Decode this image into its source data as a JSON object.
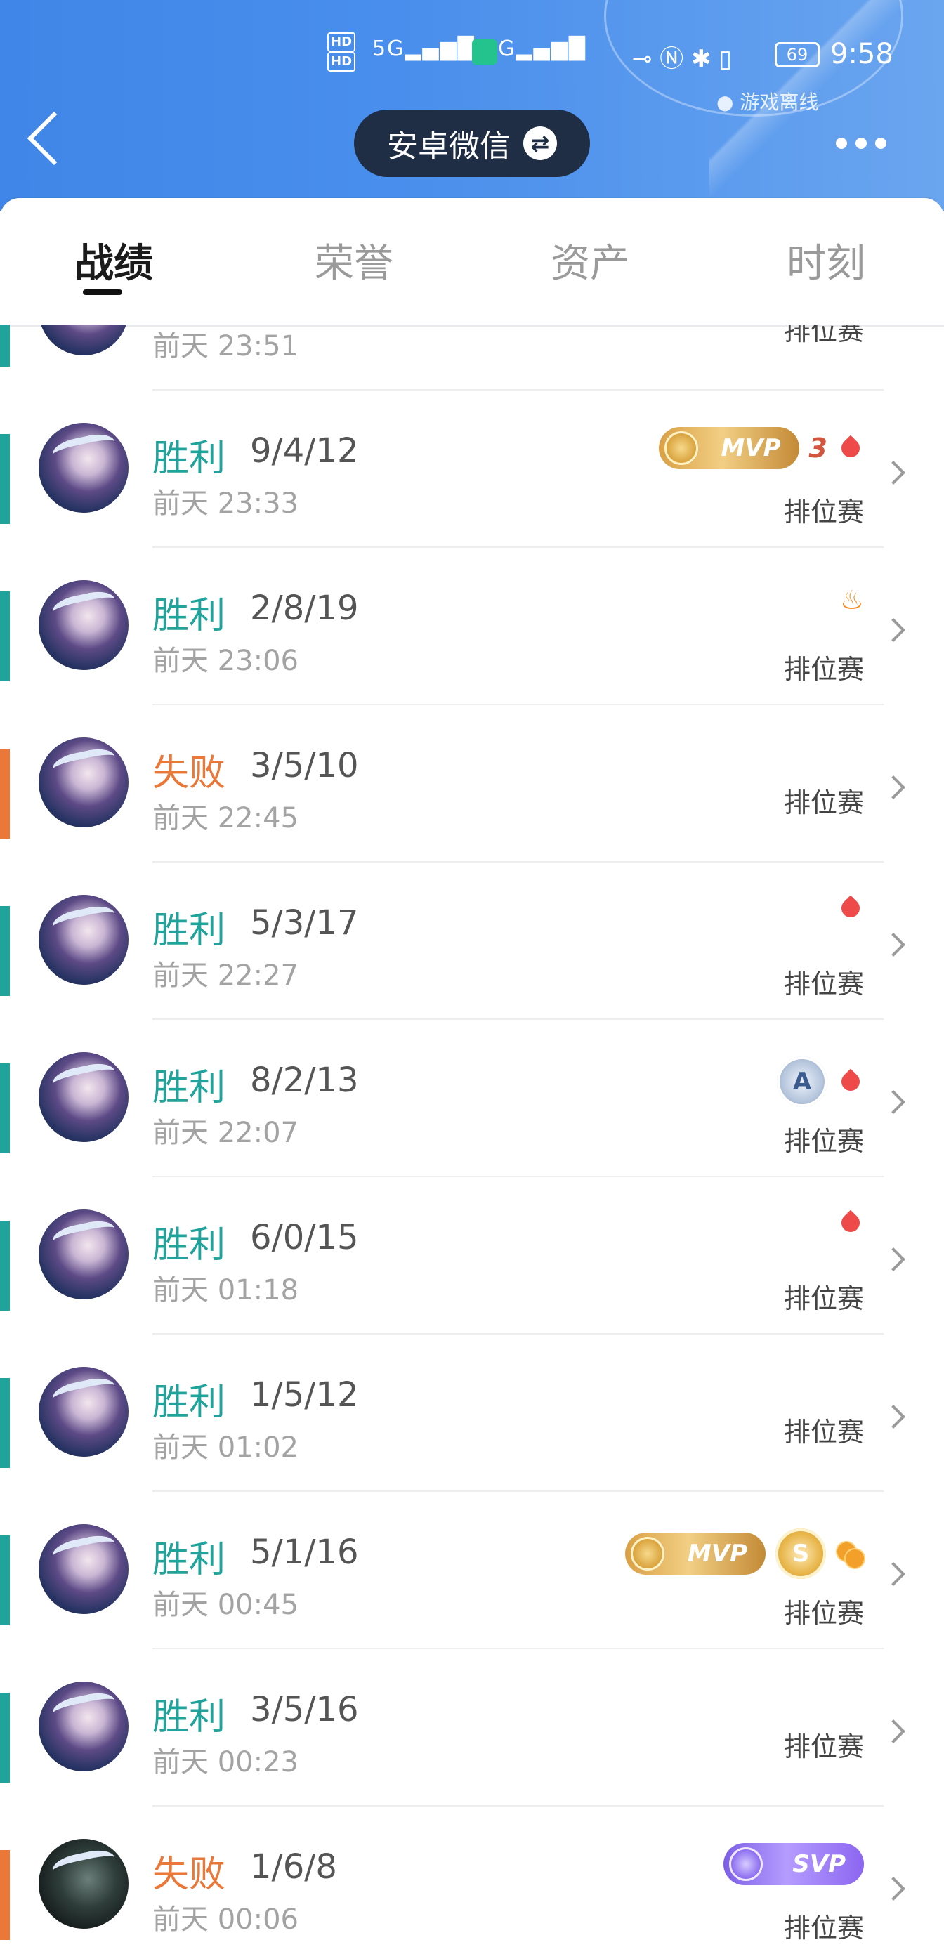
{
  "status_bar": {
    "network": "HD 5G 4G",
    "battery": "69",
    "time": "9:58",
    "presence": "游戏离线"
  },
  "header": {
    "account_label": "安卓微信"
  },
  "tabs": [
    {
      "label": "战绩"
    },
    {
      "label": "荣誉"
    },
    {
      "label": "资产"
    },
    {
      "label": "时刻"
    }
  ],
  "colors": {
    "win": "#1fa39a",
    "lose": "#ea7838",
    "accent_blue": "#4a8fec"
  },
  "matches": [
    {
      "result": "",
      "kda": "",
      "time": "前天 23:51",
      "mode": "排位赛",
      "outcome": "win",
      "badges": []
    },
    {
      "result": "胜利",
      "kda": "9/4/12",
      "time": "前天 23:33",
      "mode": "排位赛",
      "outcome": "win",
      "badges": [
        "mvp",
        "triple",
        "drop"
      ],
      "triple_label": "3",
      "mvp_label": "MVP"
    },
    {
      "result": "胜利",
      "kda": "2/8/19",
      "time": "前天 23:06",
      "mode": "排位赛",
      "outcome": "win",
      "badges": [
        "fire"
      ]
    },
    {
      "result": "失败",
      "kda": "3/5/10",
      "time": "前天 22:45",
      "mode": "排位赛",
      "outcome": "lose",
      "badges": []
    },
    {
      "result": "胜利",
      "kda": "5/3/17",
      "time": "前天 22:27",
      "mode": "排位赛",
      "outcome": "win",
      "badges": [
        "drop"
      ]
    },
    {
      "result": "胜利",
      "kda": "8/2/13",
      "time": "前天 22:07",
      "mode": "排位赛",
      "outcome": "win",
      "badges": [
        "a-coin",
        "drop"
      ],
      "a_label": "A"
    },
    {
      "result": "胜利",
      "kda": "6/0/15",
      "time": "前天 01:18",
      "mode": "排位赛",
      "outcome": "win",
      "badges": [
        "drop"
      ]
    },
    {
      "result": "胜利",
      "kda": "1/5/12",
      "time": "前天 01:02",
      "mode": "排位赛",
      "outcome": "win",
      "badges": []
    },
    {
      "result": "胜利",
      "kda": "5/1/16",
      "time": "前天 00:45",
      "mode": "排位赛",
      "outcome": "win",
      "badges": [
        "mvp",
        "s-coin",
        "coins"
      ],
      "mvp_label": "MVP",
      "s_label": "S"
    },
    {
      "result": "胜利",
      "kda": "3/5/16",
      "time": "前天 00:23",
      "mode": "排位赛",
      "outcome": "win",
      "badges": []
    },
    {
      "result": "失败",
      "kda": "1/6/8",
      "time": "前天 00:06",
      "mode": "排位赛",
      "outcome": "lose",
      "badges": [
        "svp"
      ],
      "svp_label": "SVP"
    }
  ]
}
